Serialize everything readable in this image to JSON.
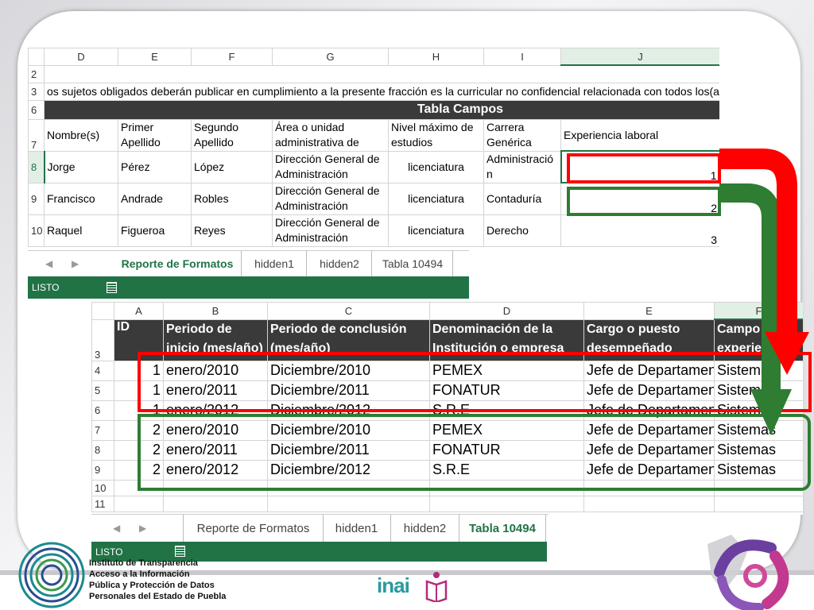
{
  "top_sheet": {
    "columns": [
      "D",
      "E",
      "F",
      "G",
      "H",
      "I",
      "J"
    ],
    "rows": {
      "r2": "2",
      "r3": "3",
      "r3_text": "os sujetos obligados deberán publicar en cumplimiento a la presente fracción es la curricular no confidencial relacionada con todos los(as",
      "r6": "6",
      "r6_title": "Tabla Campos",
      "r7": "7",
      "headers": [
        "Nombre(s)",
        "Primer Apellido",
        "Segundo Apellido",
        "Área o unidad administrativa de",
        "Nivel máximo de estudios",
        "Carrera Genérica",
        "Experiencia laboral"
      ],
      "data": [
        {
          "num": "8",
          "cells": [
            "Jorge",
            "Pérez",
            "López",
            "Dirección General de Administración",
            "licenciatura",
            "Administración",
            "1"
          ]
        },
        {
          "num": "9",
          "cells": [
            "Francisco",
            "Andrade",
            "Robles",
            "Dirección General de Administración",
            "licenciatura",
            "Contaduría",
            "2"
          ]
        },
        {
          "num": "10",
          "cells": [
            "Raquel",
            "Figueroa",
            "Reyes",
            "Dirección General de Administración",
            "licenciatura",
            "Derecho",
            "3"
          ]
        }
      ]
    },
    "tabs": [
      "Reporte de Formatos",
      "hidden1",
      "hidden2",
      "Tabla 10494"
    ],
    "active_tab": "Reporte de Formatos",
    "status": "LISTO"
  },
  "bottom_sheet": {
    "columns": [
      "A",
      "B",
      "C",
      "D",
      "E",
      "F"
    ],
    "header_row_num": "3",
    "headers": [
      "ID",
      "Periodo de inicio (mes/año)",
      "Periodo de conclusión (mes/año)",
      "Denominación de la Institución o empresa",
      "Cargo o puesto desempeñado",
      "Campo de experiencia"
    ],
    "data": [
      {
        "num": "4",
        "cells": [
          "1",
          "enero/2010",
          "Diciembre/2010",
          "PEMEX",
          "Jefe de Departamento",
          "Sistemas"
        ]
      },
      {
        "num": "5",
        "cells": [
          "1",
          "enero/2011",
          "Diciembre/2011",
          "FONATUR",
          "Jefe de Departamento",
          "Sistemas"
        ]
      },
      {
        "num": "6",
        "cells": [
          "1",
          "enero/2012",
          "Diciembre/2012",
          "S.R.E",
          "Jefe de Departamento",
          "Sistemas"
        ]
      },
      {
        "num": "7",
        "cells": [
          "2",
          "enero/2010",
          "Diciembre/2010",
          "PEMEX",
          "Jefe de Departamento",
          "Sistemas"
        ]
      },
      {
        "num": "8",
        "cells": [
          "2",
          "enero/2011",
          "Diciembre/2011",
          "FONATUR",
          "Jefe de Departamento",
          "Sistemas"
        ]
      },
      {
        "num": "9",
        "cells": [
          "2",
          "enero/2012",
          "Diciembre/2012",
          "S.R.E",
          "Jefe de Departamento",
          "Sistemas"
        ]
      }
    ],
    "empty_rows": [
      "10",
      "11"
    ],
    "tabs": [
      "Reporte de Formatos",
      "hidden1",
      "hidden2",
      "Tabla 10494"
    ],
    "active_tab": "Tabla 10494",
    "status": "LISTO"
  },
  "footer": {
    "org_lines": [
      "Instituto de Transparencia",
      "Acceso a la Información",
      "Pública y Protección de Datos",
      "Personales del Estado de Puebla"
    ],
    "inai_logo": "inai"
  },
  "colors": {
    "excel_green": "#217346",
    "red_highlight": "#ff0000",
    "green_highlight": "#2e7d32",
    "header_dark": "#3a3a3a"
  },
  "icons": [
    "arrow-left-icon",
    "arrow-right-icon",
    "sheet-stats-icon",
    "red-arrow-icon",
    "green-arrow-icon",
    "itaipue-logo-icon",
    "inai-logo-icon",
    "puebla-logo-icon"
  ]
}
